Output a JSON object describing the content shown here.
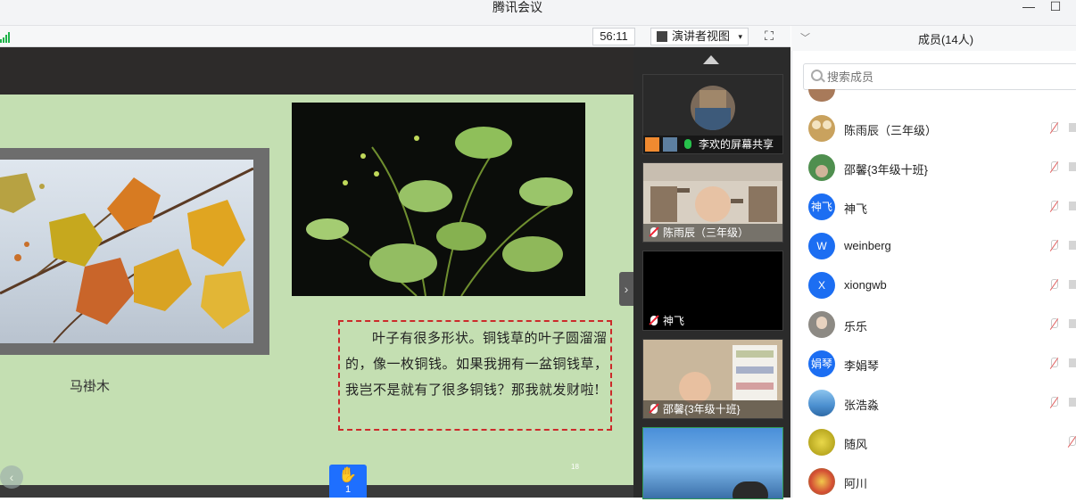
{
  "app": {
    "title": "腾讯会议",
    "minimize_icon": "minimize-icon",
    "restore_icon": "restore-icon"
  },
  "toolbar": {
    "timer": "56:11",
    "view_label": "演讲者视图",
    "view_caret": "▾",
    "fullscreen_icon": "fullscreen-icon"
  },
  "slide": {
    "tulip_caption": "马褂木",
    "text": "叶子有很多形状。铜钱草的叶子圆溜溜的，像一枚铜钱。如果我拥有一盆铜钱草，我岂不是就有了很多铜钱？那我就发财啦!",
    "page_number": "18"
  },
  "raise_hand": {
    "count": "1"
  },
  "videos": [
    {
      "name": "李欢的屏幕共享",
      "mic": "green"
    },
    {
      "name": "陈雨辰（三年级）",
      "mic": "muted"
    },
    {
      "name": "神飞",
      "mic": "muted"
    },
    {
      "name": "邵馨{3年级十班}",
      "mic": "muted"
    }
  ],
  "panel": {
    "title": "成员(14人)",
    "search_placeholder": "搜索成员"
  },
  "members": [
    {
      "name": "陈雨辰（三年级）",
      "avatar_text": "",
      "avatar_color": "#c9a25e"
    },
    {
      "name": "邵馨{3年级十班}",
      "avatar_text": "",
      "avatar_color": "#4f8f4f"
    },
    {
      "name": "神飞",
      "avatar_text": "神飞",
      "avatar_color": "#1c6ef2"
    },
    {
      "name": "weinberg",
      "avatar_text": "W",
      "avatar_color": "#1c6ef2"
    },
    {
      "name": "xiongwb",
      "avatar_text": "X",
      "avatar_color": "#1c6ef2"
    },
    {
      "name": "乐乐",
      "avatar_text": "",
      "avatar_color": "#8d8a84"
    },
    {
      "name": "李娟琴",
      "avatar_text": "娟琴",
      "avatar_color": "#1c6ef2"
    },
    {
      "name": "张浩淼",
      "avatar_text": "",
      "avatar_color": "#6aa7d8"
    },
    {
      "name": "随风",
      "avatar_text": "",
      "avatar_color": "#c8b32a"
    },
    {
      "name": "阿川",
      "avatar_text": "",
      "avatar_color": "#d34b33"
    }
  ]
}
